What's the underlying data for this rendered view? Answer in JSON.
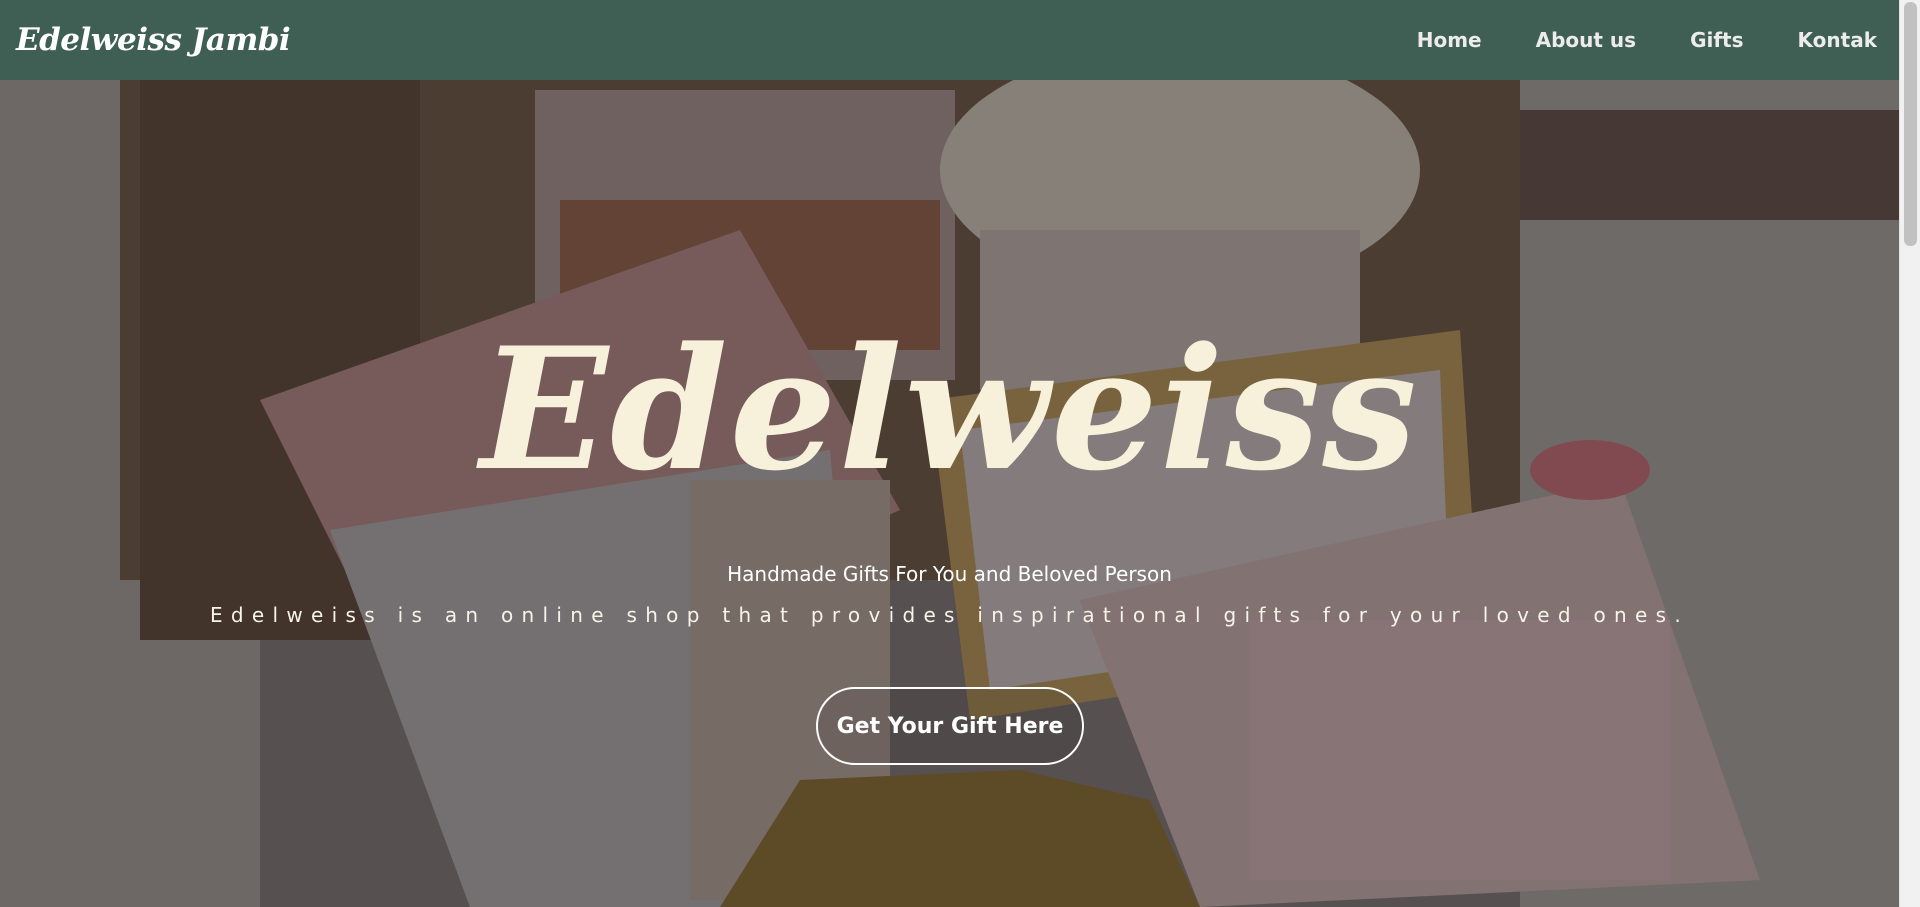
{
  "navbar": {
    "brand": "Edelweiss Jambi",
    "links": [
      {
        "label": "Home"
      },
      {
        "label": "About us"
      },
      {
        "label": "Gifts"
      },
      {
        "label": "Kontak"
      }
    ]
  },
  "hero": {
    "title": "Edelweiss",
    "subtitle": "Handmade Gifts For You and Beloved Person",
    "description": "Edelweiss is an online shop that provides inspirational gifts for your loved ones.",
    "cta_label": "Get Your Gift Here"
  },
  "colors": {
    "navbar_bg": "#405f54",
    "title_color": "#f7f0da",
    "button_border": "#ffffff"
  },
  "icons": {
    "background": "gift-box-photo"
  }
}
